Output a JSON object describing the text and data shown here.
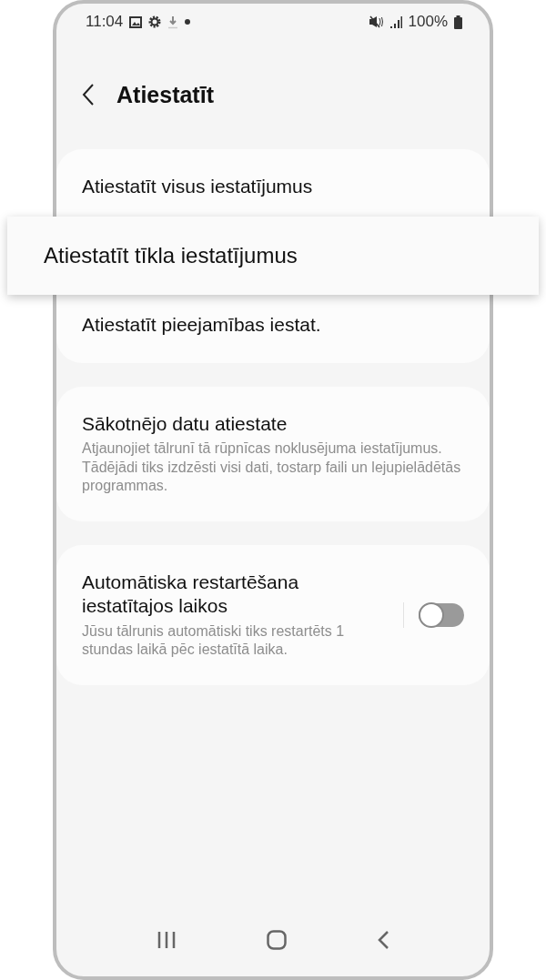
{
  "status_bar": {
    "time": "11:04",
    "battery": "100%"
  },
  "header": {
    "title": "Atiestatīt"
  },
  "cards": [
    {
      "items": [
        {
          "title": "Atiestatīt visus iestatījumus",
          "highlighted": false
        },
        {
          "title": "Atiestatīt tīkla iestatījumus",
          "highlighted": true
        },
        {
          "title": "Atiestatīt pieejamības iestat.",
          "highlighted": false
        }
      ]
    },
    {
      "items": [
        {
          "title": "Sākotnējo datu atiestate",
          "subtitle": "Atjaunojiet tālrunī tā rūpnīcas noklusējuma iestatījumus. Tādējādi tiks izdzēsti visi dati, tostarp faili un lejupielādētās programmas.",
          "highlighted": false
        }
      ]
    },
    {
      "items": [
        {
          "title": "Automātiska restartēšana iestatītajos laikos",
          "subtitle": "Jūsu tālrunis automātiski tiks restartēts 1 stundas laikā pēc iestatītā laika.",
          "highlighted": false,
          "toggle": {
            "on": false
          }
        }
      ]
    }
  ]
}
